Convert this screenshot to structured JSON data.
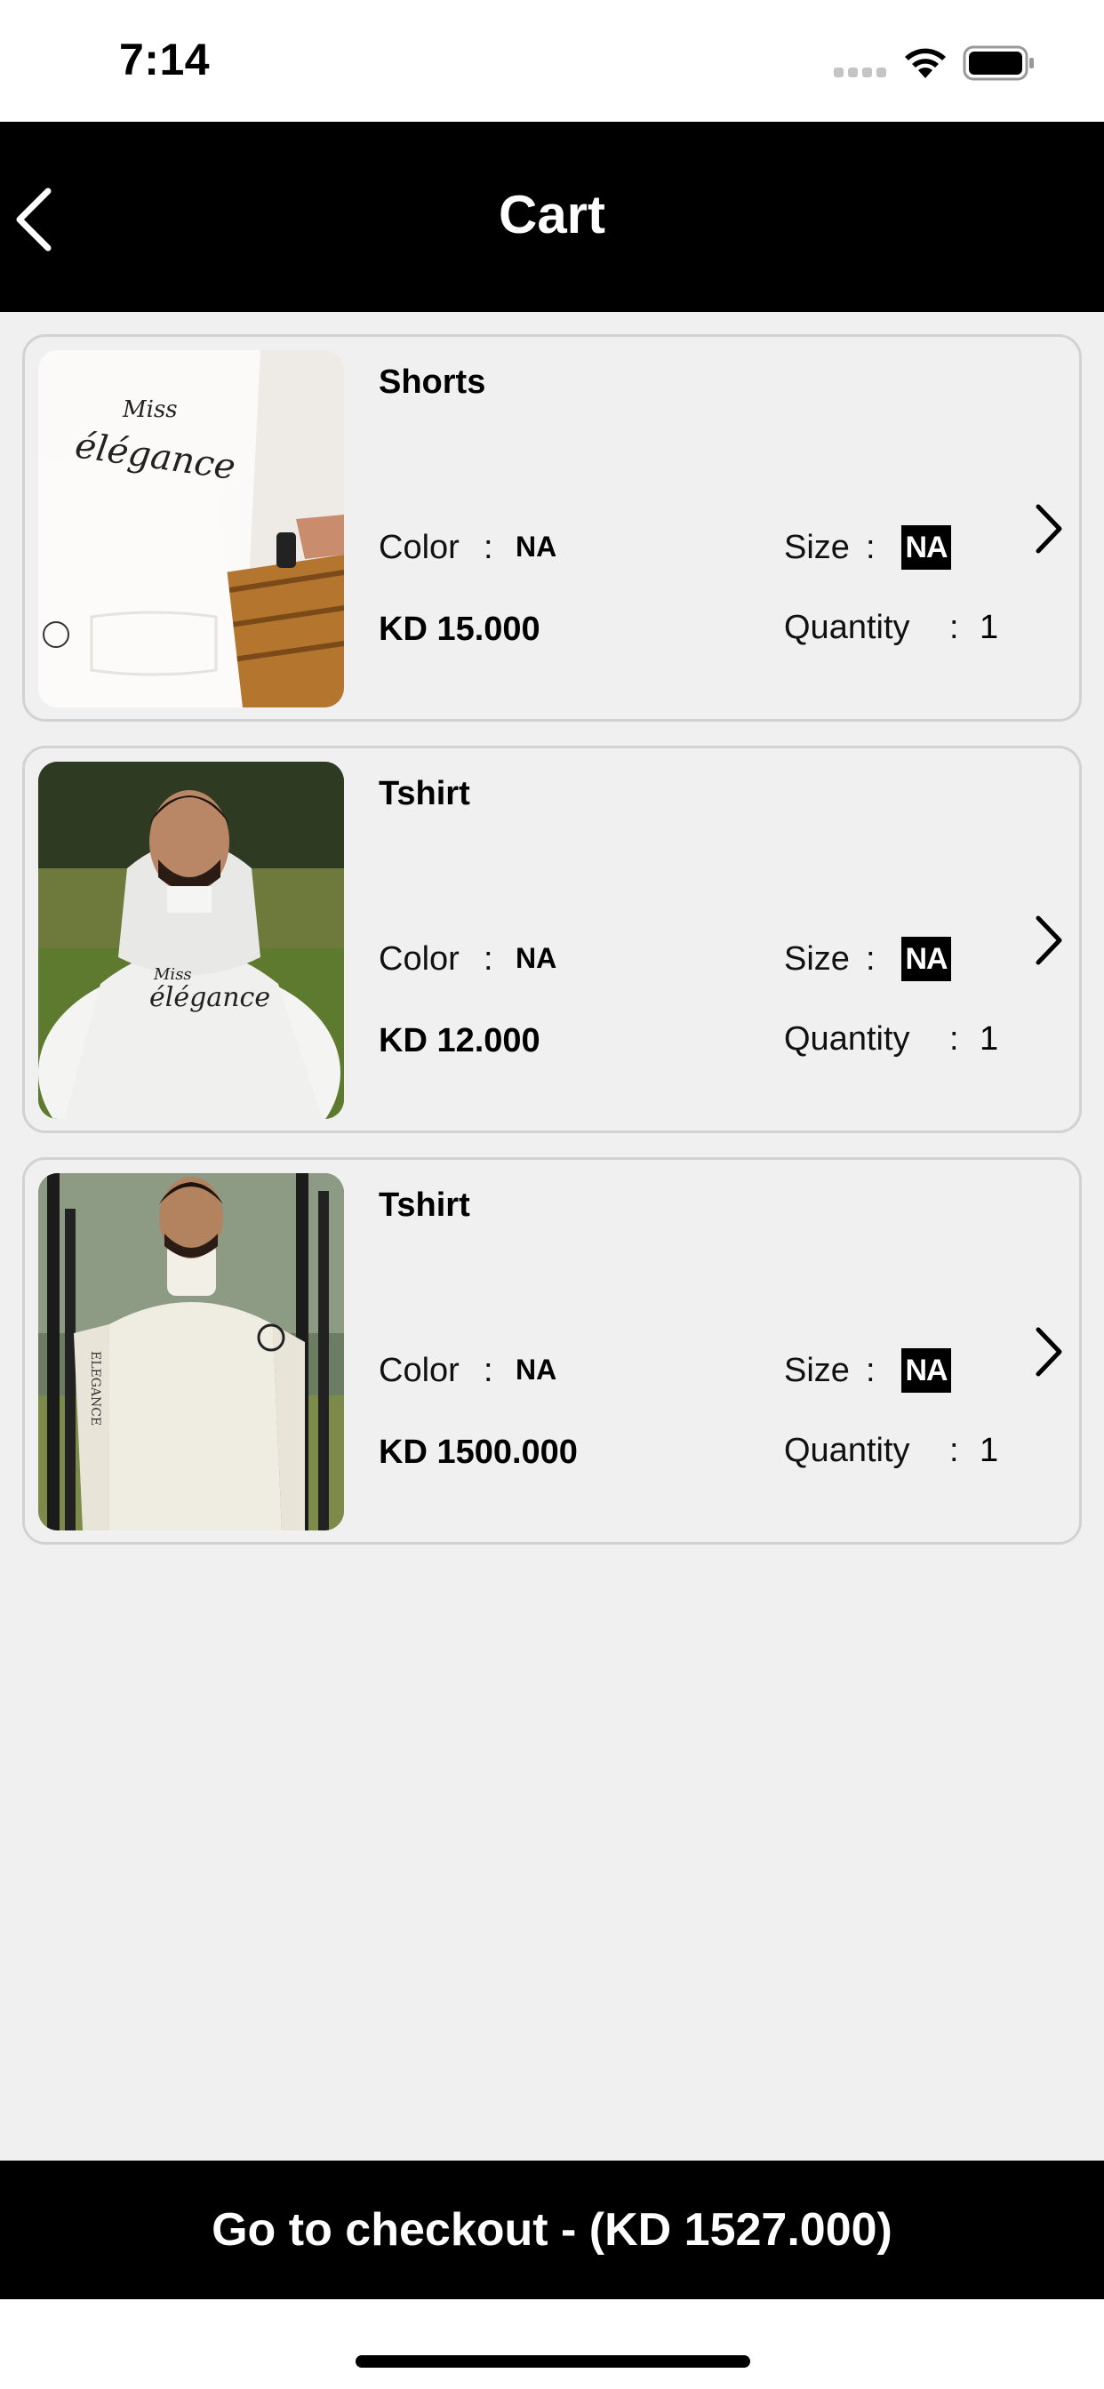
{
  "status_bar": {
    "time": "7:14",
    "icons": [
      "cellular-signal-icon",
      "wifi-icon",
      "battery-icon"
    ]
  },
  "header": {
    "title": "Cart",
    "back_icon": "chevron-left-icon"
  },
  "labels": {
    "color": "Color",
    "size": "Size",
    "quantity": "Quantity",
    "separator": ":"
  },
  "cart_items": [
    {
      "name": "Shorts",
      "color": "NA",
      "size": "NA",
      "price": "KD 15.000",
      "quantity": "1",
      "image": "white hoodie with Miss élégance script print"
    },
    {
      "name": "Tshirt",
      "color": "NA",
      "size": "NA",
      "price": "KD 12.000",
      "quantity": "1",
      "image": "man wearing white hoodie outdoors"
    },
    {
      "name": "Tshirt",
      "color": "NA",
      "size": "NA",
      "price": "KD 1500.000",
      "quantity": "1",
      "image": "man wearing white turtleneck sweater"
    }
  ],
  "checkout": {
    "label": "Go to checkout - (KD 1527.000)"
  },
  "colors": {
    "header_bg": "#000000",
    "page_bg": "#f0f0f0",
    "card_border": "#d2d2d2",
    "button_bg": "#000000",
    "button_text": "#ffffff"
  }
}
